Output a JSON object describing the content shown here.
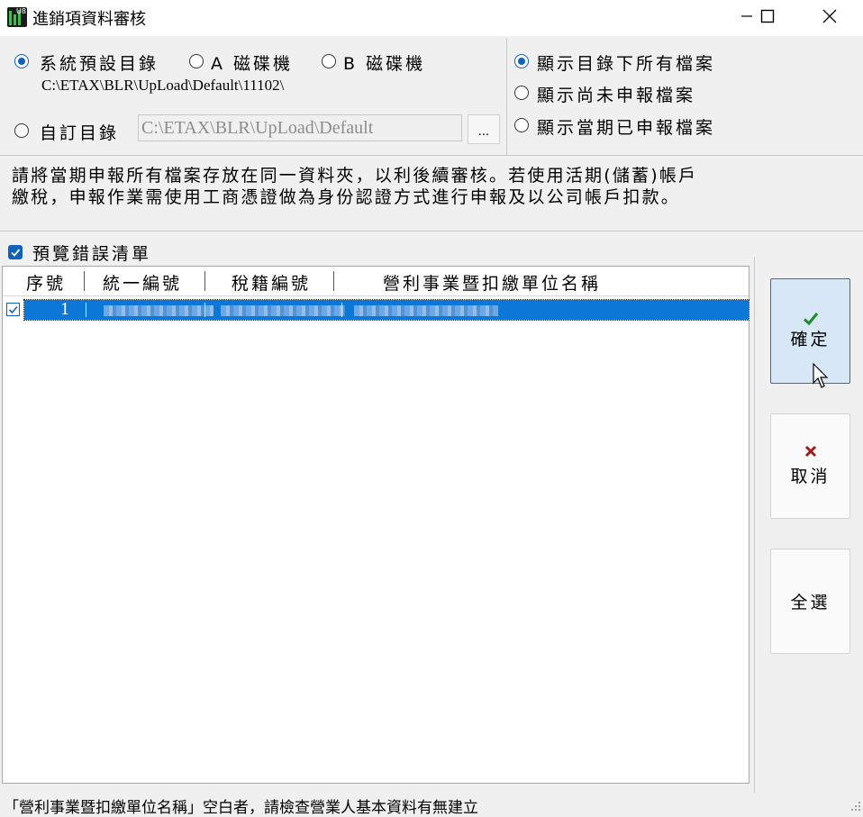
{
  "window": {
    "title": "進銷項資料審核",
    "icon_label": "U8",
    "controls": {
      "minimize": "—",
      "maximize": "☐",
      "close": "✕"
    }
  },
  "directory": {
    "options": [
      {
        "label": "系統預設目錄",
        "selected": true
      },
      {
        "label": "A 磁碟機",
        "selected": false
      },
      {
        "label": "B 磁碟機",
        "selected": false
      }
    ],
    "default_path": "C:\\ETAX\\BLR\\UpLoad\\Default\\11102\\",
    "custom_option": {
      "label": "自訂目錄",
      "selected": false
    },
    "custom_path": "C:\\ETAX\\BLR\\UpLoad\\Default",
    "browse_label": "..."
  },
  "display_mode": {
    "options": [
      {
        "label": "顯示目錄下所有檔案",
        "selected": true
      },
      {
        "label": "顯示尚未申報檔案",
        "selected": false
      },
      {
        "label": "顯示當期已申報檔案",
        "selected": false
      }
    ]
  },
  "notice": {
    "line1": "請將當期申報所有檔案存放在同一資料夾，以利後續審核。若使用活期(儲蓄)帳戶",
    "line2": "繳稅，申報作業需使用工商憑證做為身份認證方式進行申報及以公司帳戶扣款。"
  },
  "preview_errors": {
    "label": "預覽錯誤清單",
    "checked": true
  },
  "list": {
    "columns": [
      "序號",
      "統一編號",
      "稅籍編號",
      "營利事業暨扣繳單位名稱"
    ],
    "rows": [
      {
        "checked": true,
        "index": "1",
        "selected": true
      }
    ]
  },
  "buttons": {
    "ok": {
      "label": "確定",
      "icon": "check-icon"
    },
    "cancel": {
      "label": "取消",
      "icon": "x-icon"
    },
    "select_all": {
      "label": "全選"
    }
  },
  "status_bar": {
    "text": "「營利事業暨扣繳單位名稱」空白者，請檢查營業人基本資料有無建立"
  },
  "colors": {
    "accent": "#0f62b7",
    "selection": "#0b78d7",
    "ok_bg": "#d8e7f5",
    "check_green": "#1a8c2a",
    "cancel_red": "#9c1c1c"
  }
}
